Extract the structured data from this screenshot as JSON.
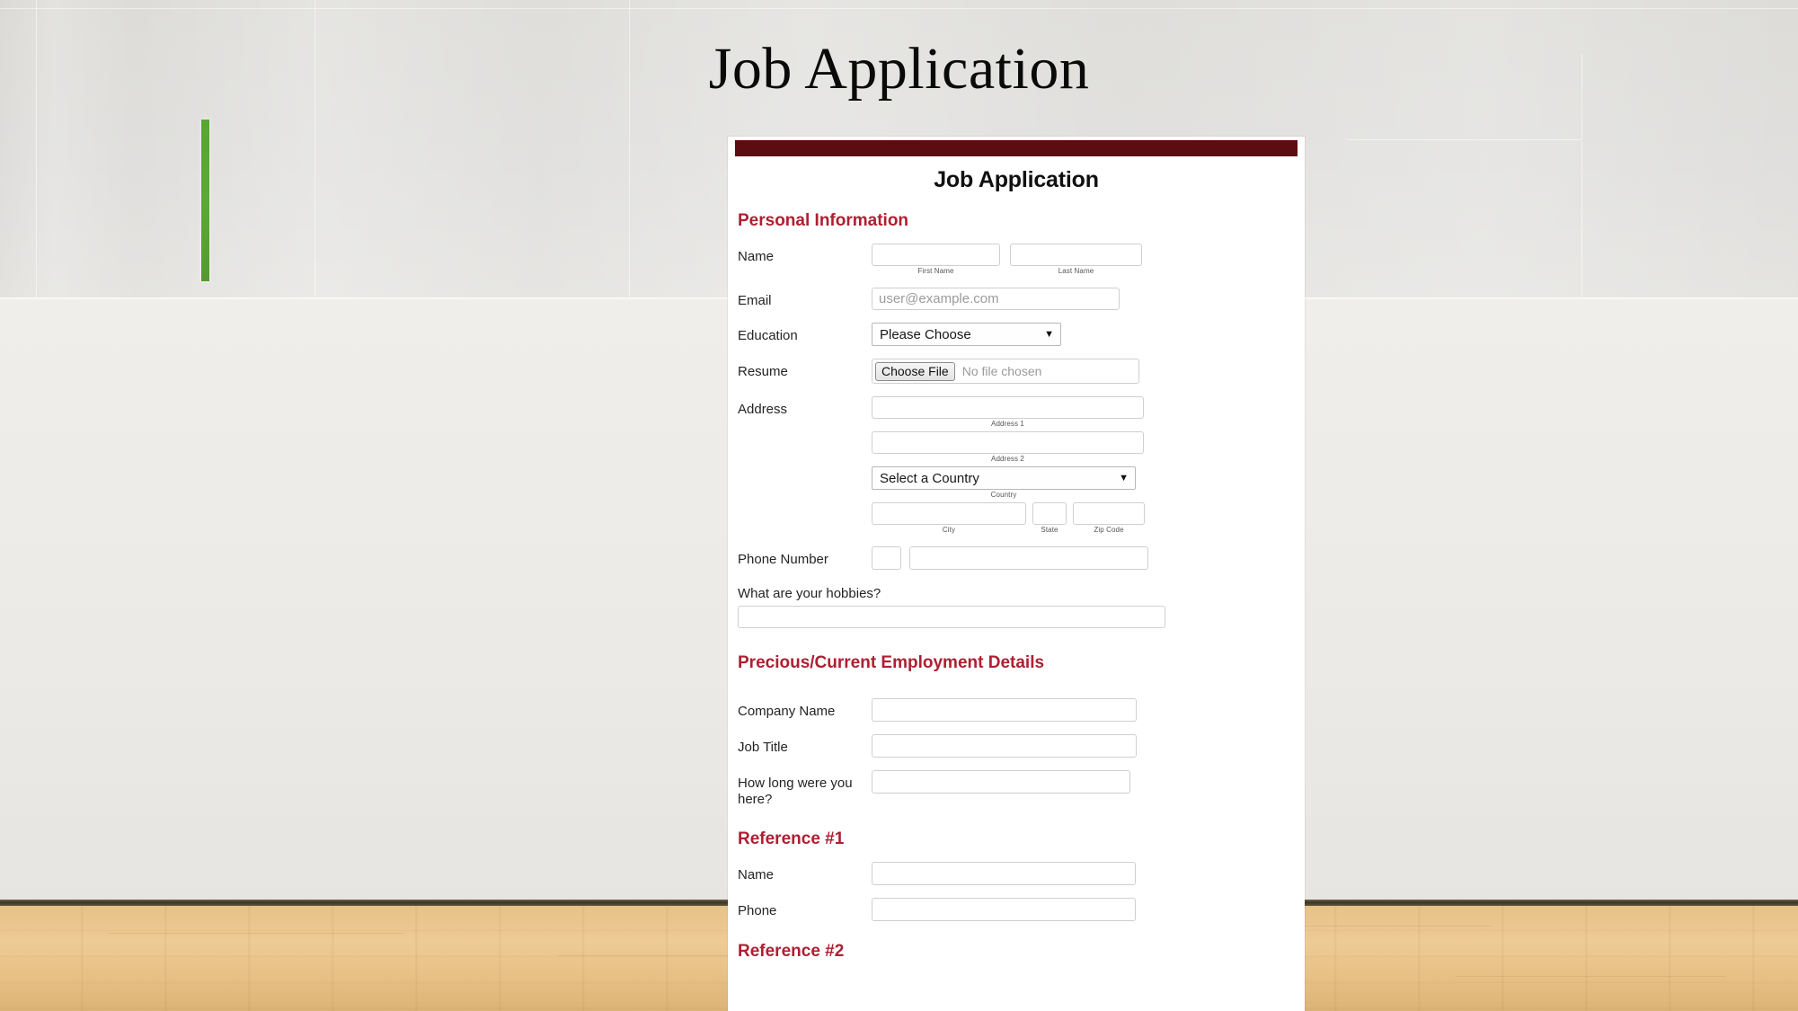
{
  "slide": {
    "title": "Job Application"
  },
  "form": {
    "title": "Job Application",
    "sections": {
      "personal": "Personal Information",
      "employment": "Precious/Current Employment Details",
      "reference1": "Reference #1",
      "reference2": "Reference #2"
    },
    "name": {
      "label": "Name",
      "first_sublabel": "First Name",
      "last_sublabel": "Last Name",
      "first_value": "",
      "last_value": ""
    },
    "email": {
      "label": "Email",
      "placeholder": "user@example.com",
      "value": ""
    },
    "education": {
      "label": "Education",
      "selected": "Please Choose",
      "caret": "▼"
    },
    "resume": {
      "label": "Resume",
      "button": "Choose File",
      "status": "No file chosen"
    },
    "address": {
      "label": "Address",
      "line1_sublabel": "Address 1",
      "line2_sublabel": "Address 2",
      "country_selected": "Select a Country",
      "country_sublabel": "Country",
      "city_sublabel": "City",
      "state_sublabel": "State",
      "zip_sublabel": "Zip Code",
      "caret": "▼",
      "line1_value": "",
      "line2_value": "",
      "city_value": "",
      "state_value": "",
      "zip_value": ""
    },
    "phone": {
      "label": "Phone Number",
      "code_value": "",
      "number_value": ""
    },
    "hobbies": {
      "question": "What are your hobbies?",
      "value": ""
    },
    "employment": {
      "company_label": "Company Name",
      "company_value": "",
      "job_title_label": "Job Title",
      "job_title_value": "",
      "duration_label": "How long were you here?",
      "duration_value": ""
    },
    "reference1": {
      "name_label": "Name",
      "name_value": "",
      "phone_label": "Phone",
      "phone_value": ""
    }
  },
  "colors": {
    "maroon_bar": "#5c0d10",
    "section_heading": "#ae1f31",
    "accent_green": "#5aa532",
    "floor": "#e7c288",
    "wall_upper": "#dbdad6",
    "wall_lower": "#efeeeb"
  }
}
